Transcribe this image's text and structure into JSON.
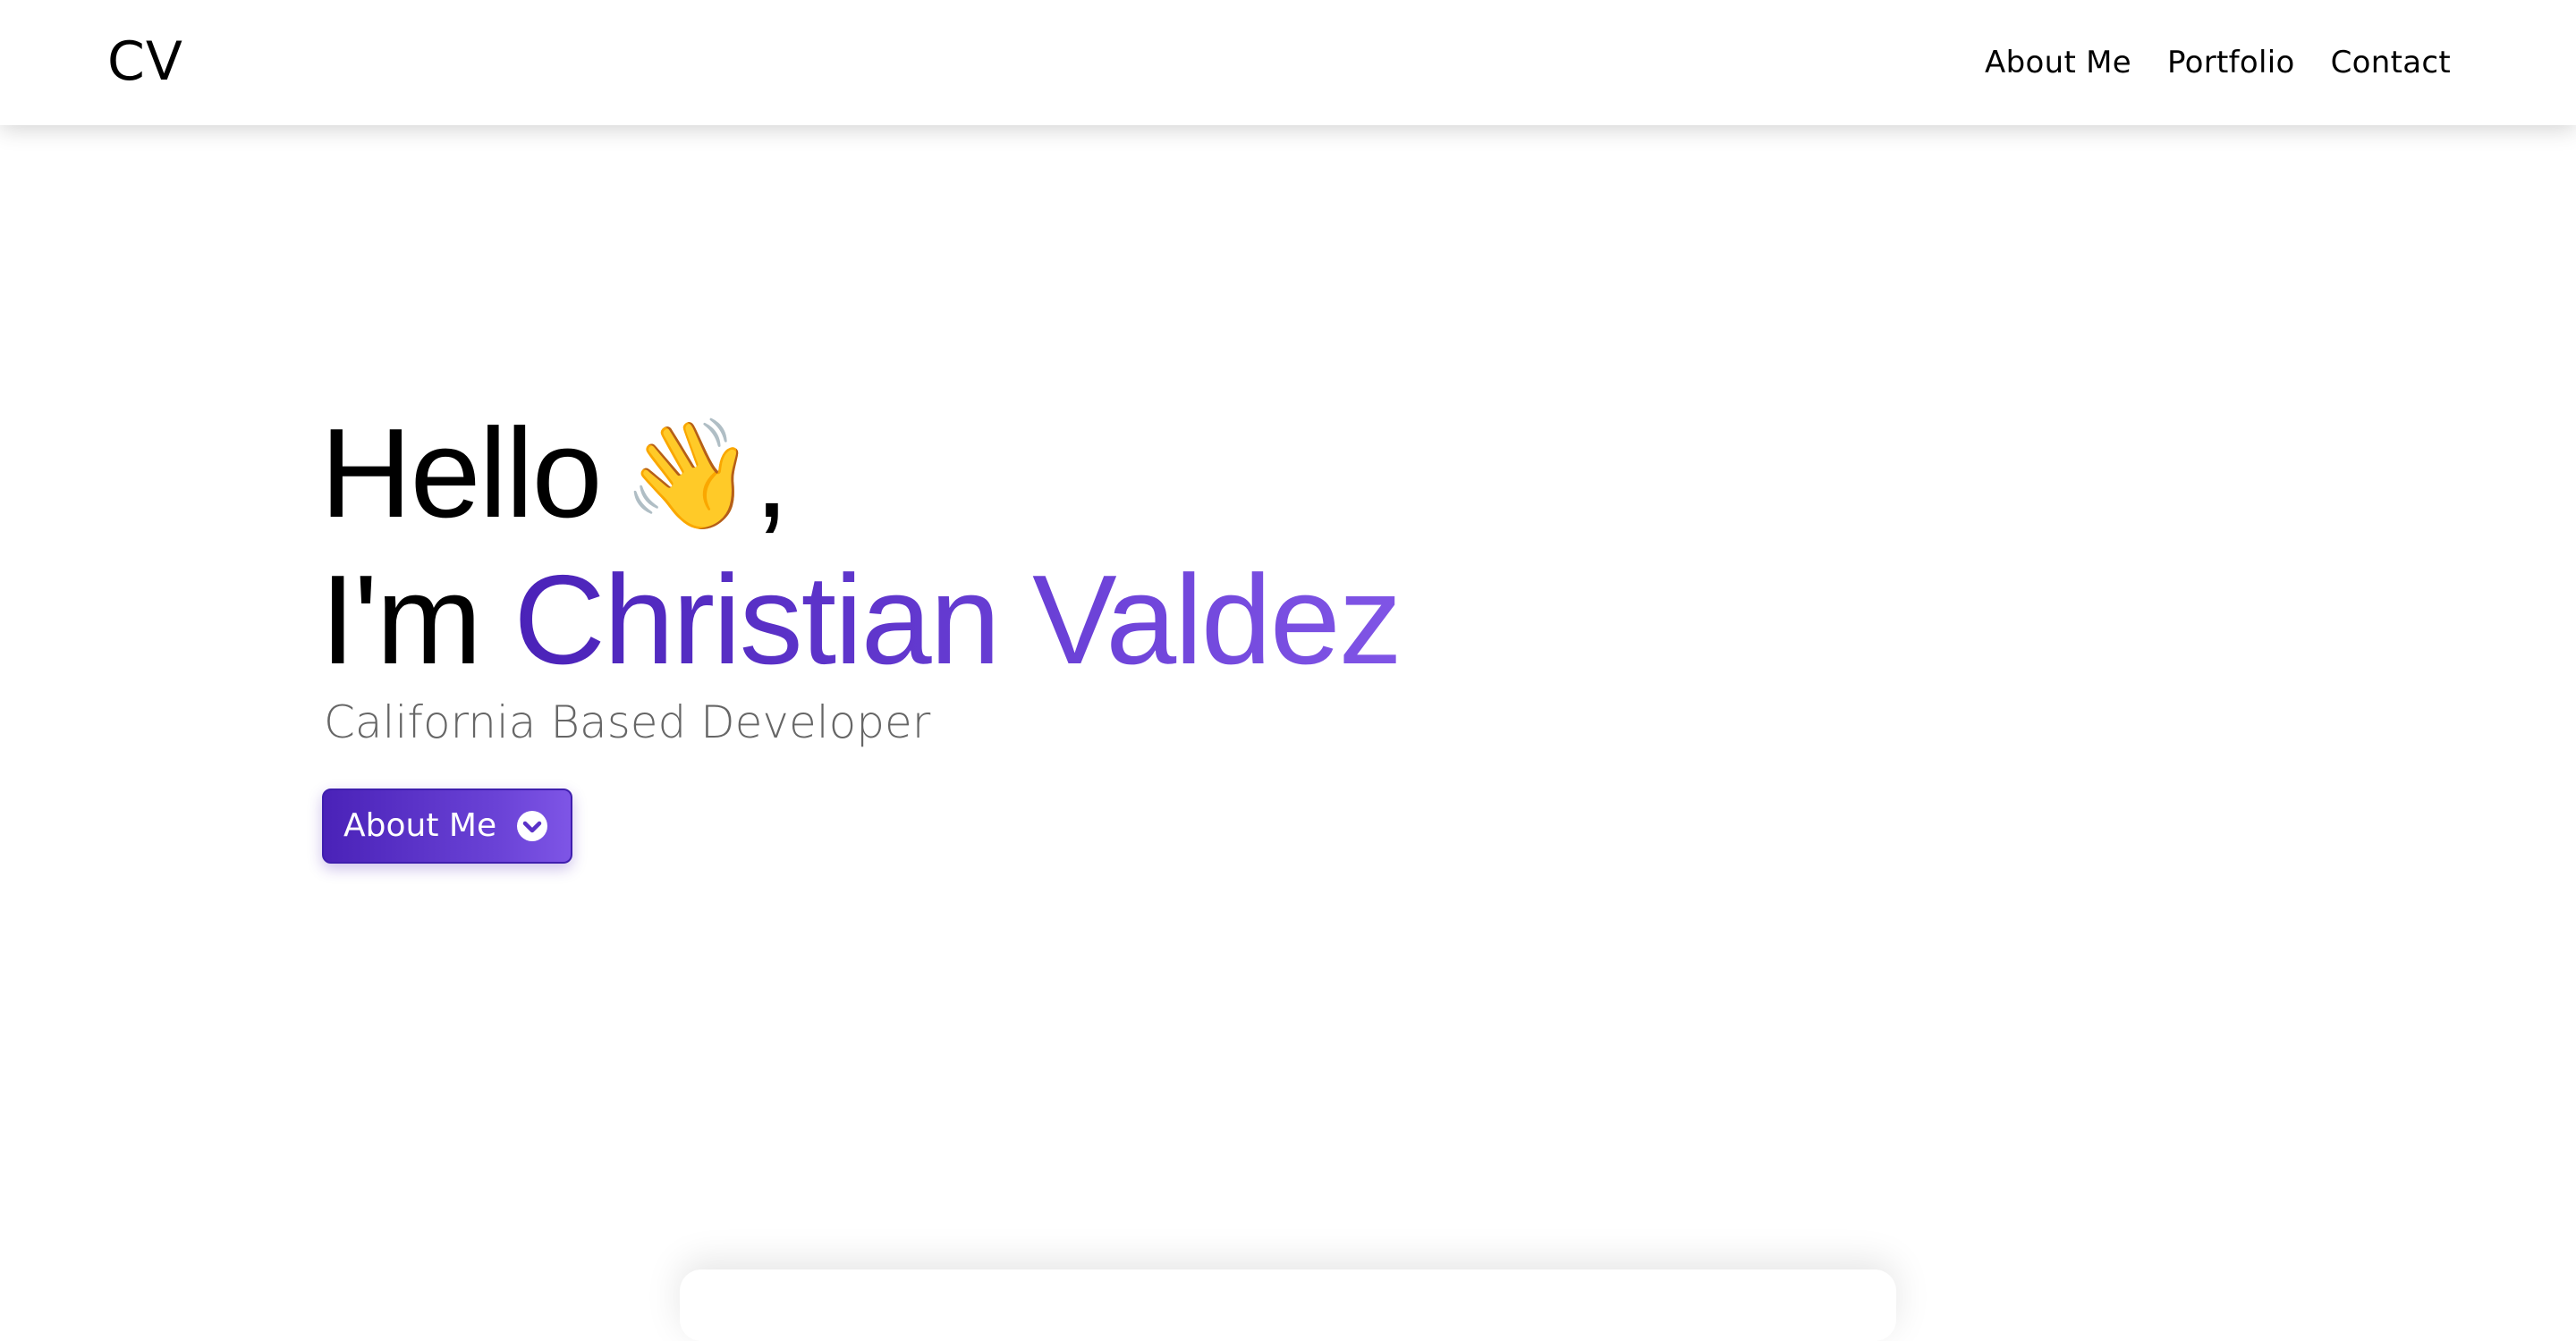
{
  "navbar": {
    "logo": "CV",
    "links": [
      {
        "label": "About Me"
      },
      {
        "label": "Portfolio"
      },
      {
        "label": "Contact"
      }
    ]
  },
  "hero": {
    "greeting": "Hello",
    "greeting_emoji": "👋",
    "greeting_suffix": ",",
    "intro_prefix": "I'm",
    "name": "Christian Valdez",
    "subtitle": "California Based Developer",
    "cta_label": "About Me",
    "cta_icon": "chevron-down-circle-icon"
  },
  "colors": {
    "accent_start": "#4a22b8",
    "accent_end": "#8055e6",
    "subtitle": "#666666",
    "text": "#000000"
  }
}
